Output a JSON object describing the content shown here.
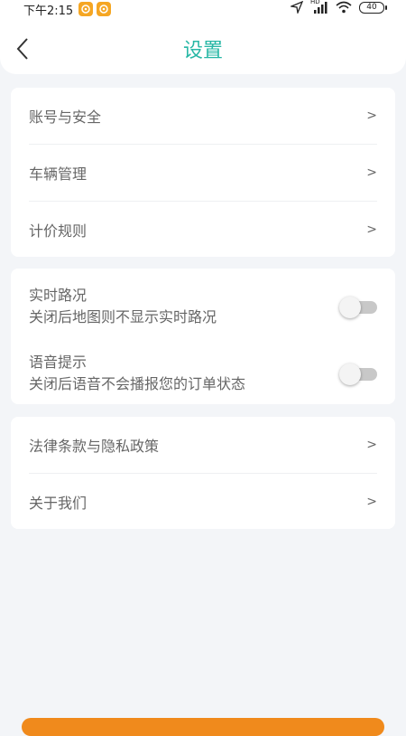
{
  "status_bar": {
    "time": "下午2:15",
    "battery": "40",
    "signal_label": "HD"
  },
  "header": {
    "title": "设置"
  },
  "account_section": {
    "items": [
      {
        "label": "账号与安全",
        "arrow": ">"
      },
      {
        "label": "车辆管理",
        "arrow": ">"
      },
      {
        "label": "计价规则",
        "arrow": ">"
      }
    ]
  },
  "toggles_section": {
    "items": [
      {
        "title": "实时路况",
        "subtitle": "关闭后地图则不显示实时路况",
        "enabled": false
      },
      {
        "title": "语音提示",
        "subtitle": "关闭后语音不会播报您的订单状态",
        "enabled": false
      }
    ]
  },
  "info_section": {
    "items": [
      {
        "label": "法律条款与隐私政策",
        "arrow": ">"
      },
      {
        "label": "关于我们",
        "arrow": ">"
      }
    ]
  },
  "colors": {
    "accent": "#27b7a5",
    "bottom_button": "#f08a1c",
    "background": "#f3f5f8"
  }
}
